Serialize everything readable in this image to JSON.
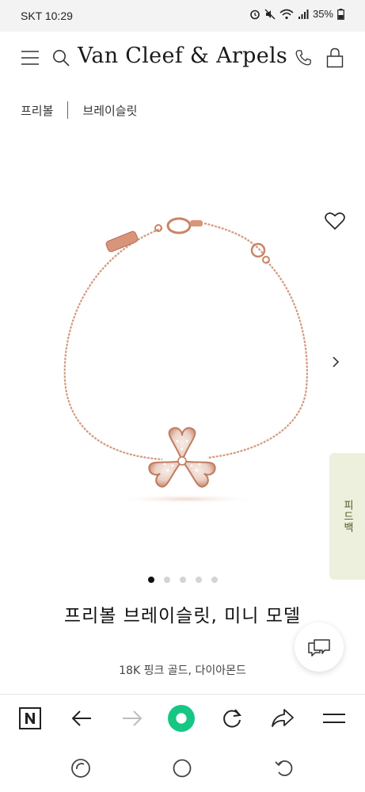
{
  "status_bar": {
    "carrier_time": "SKT 10:29",
    "battery": "35%"
  },
  "header": {
    "brand": "Van Cleef & Arpels"
  },
  "breadcrumb": {
    "items": [
      "프리볼",
      "브레이슬릿"
    ]
  },
  "carousel": {
    "slide_count": 5,
    "active_index": 0
  },
  "feedback_tab": {
    "label": "피드백"
  },
  "product": {
    "title": "프리볼 브레이슬릿, 미니 모델",
    "materials": "18K 핑크 골드, 다이아몬드"
  },
  "colors": {
    "rose_gold": "#d79a7f",
    "rose_gold_dark": "#b5755c",
    "browser_green": "#16c784",
    "feedback_bg": "#eef0de"
  }
}
